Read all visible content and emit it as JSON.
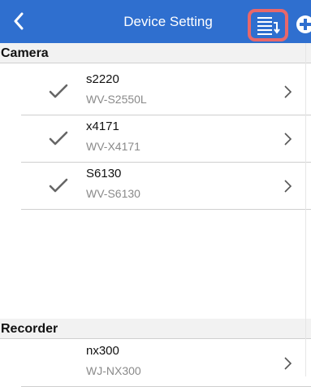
{
  "header": {
    "title": "Device Setting",
    "back_icon": "back-chevron-icon",
    "sort_icon": "sort-list-icon",
    "add_icon": "add-circle-icon",
    "background": "#2f6fcf",
    "highlight": "#e8676a"
  },
  "camera_section": {
    "label": "Camera",
    "items": [
      {
        "name": "s2220",
        "model": "WV-S2550L",
        "checked": true
      },
      {
        "name": "x4171",
        "model": "WV-X4171",
        "checked": true
      },
      {
        "name": "S6130",
        "model": "WV-S6130",
        "checked": true
      }
    ]
  },
  "recorder_section": {
    "label": "Recorder",
    "items": [
      {
        "name": "nx300",
        "model": "WJ-NX300",
        "checked": false
      }
    ]
  }
}
